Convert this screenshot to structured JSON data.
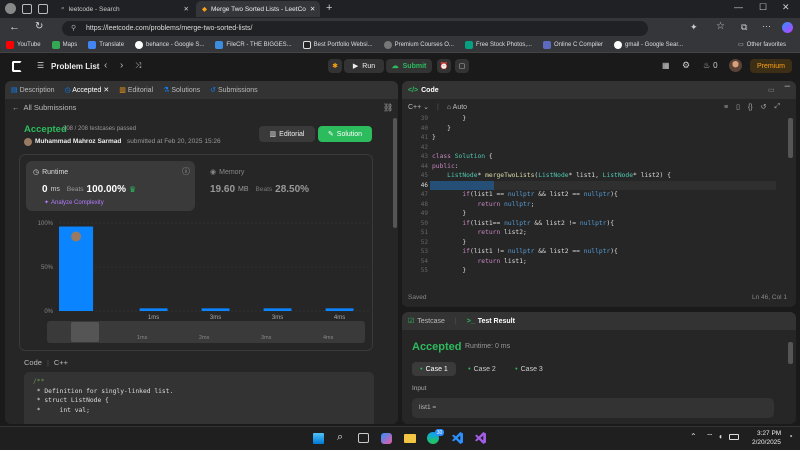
{
  "browser": {
    "tabs": [
      {
        "label": "leetcode - Search"
      },
      {
        "label": "Merge Two Sorted Lists - LeetCo"
      }
    ],
    "url": "https://leetcode.com/problems/merge-two-sorted-lists/",
    "bookmarks": [
      "YouTube",
      "Maps",
      "Translate",
      "behance - Google S...",
      "FileCR - THE BIGGES...",
      "Best Portfolio Websi...",
      "Premium Courses O...",
      "Free Stock Photos,...",
      "Online C Compiler",
      "gmail - Google Sear..."
    ],
    "other_bookmarks": "Other favorites",
    "colors": {
      "tabbar": "#202124",
      "toolbar": "#35363a"
    }
  },
  "header": {
    "problem_list": "Problem List",
    "run": "Run",
    "submit": "Submit",
    "streak": "0",
    "premium": "Premium",
    "accent": "#2cbb5d",
    "premium_color": "#ffa116"
  },
  "left_tabs": [
    "Description",
    "Accepted",
    "Editorial",
    "Solutions",
    "Submissions"
  ],
  "all_submissions": "All Submissions",
  "result": {
    "status": "Accepted",
    "passed": "208 / 208 testcases passed",
    "user": "Muhammad Mahroz Sarmad",
    "submitted": "submitted at Feb 20, 2025 15:26",
    "editorial_btn": "Editorial",
    "solution_btn": "Solution"
  },
  "runtime": {
    "label": "Runtime",
    "value": "0",
    "unit": "ms",
    "beats": "Beats",
    "pct": "100.00%",
    "analyze": "Analyze Complexity"
  },
  "memory": {
    "label": "Memory",
    "value": "19.60",
    "unit": "MB",
    "beats": "Beats",
    "pct": "28.50%"
  },
  "chart_data": {
    "type": "bar",
    "categories": [
      "0ms",
      "1ms",
      "2ms",
      "3ms",
      "4ms"
    ],
    "yticks": [
      "100%",
      "50%",
      "0%"
    ],
    "xlabels": [
      "1ms",
      "3ms",
      "3ms",
      "4ms"
    ],
    "values": [
      96,
      3,
      3,
      3,
      3
    ],
    "ylim": [
      0,
      100
    ],
    "bar_color": "#0a84ff",
    "range_labels": [
      "1ms",
      "2ms",
      "3ms",
      "4ms"
    ]
  },
  "code_section": {
    "label": "Code",
    "lang": "C++",
    "lines": [
      "/**",
      " * Definition for singly-linked list.",
      " * struct ListNode {",
      " *     int val;"
    ]
  },
  "editor": {
    "title": "Code",
    "lang": "C++",
    "auto": "Auto",
    "saved": "Saved",
    "cursor": "Ln 46, Col 1",
    "line_numbers": [
      "39",
      "40",
      "41",
      "42",
      "43",
      "44",
      "45",
      "46",
      "47",
      "48",
      "49",
      "50",
      "51",
      "52",
      "53",
      "54",
      "55"
    ],
    "lines": [
      "        }",
      "    }",
      "}",
      "",
      "class Solution {",
      "public:",
      "    ListNode* mergeTwoLists(ListNode* list1, ListNode* list2) {",
      "",
      "        if(list1 == nullptr && list2 == nullptr){",
      "            return nullptr;",
      "        }",
      "        if(list1== nullptr && list2 != nullptr){",
      "            return list2;",
      "        }",
      "        if(list1 != nullptr && list2 == nullptr){",
      "            return list1;",
      "        }"
    ]
  },
  "testpanel": {
    "tab1": "Testcase",
    "tab2": "Test Result",
    "status": "Accepted",
    "runtime": "Runtime: 0 ms",
    "cases": [
      "Case 1",
      "Case 2",
      "Case 3"
    ],
    "input_label": "Input",
    "input_value": "list1 ="
  },
  "taskbar": {
    "time": "3:27 PM",
    "date": "2/20/2025",
    "badge": "30"
  }
}
